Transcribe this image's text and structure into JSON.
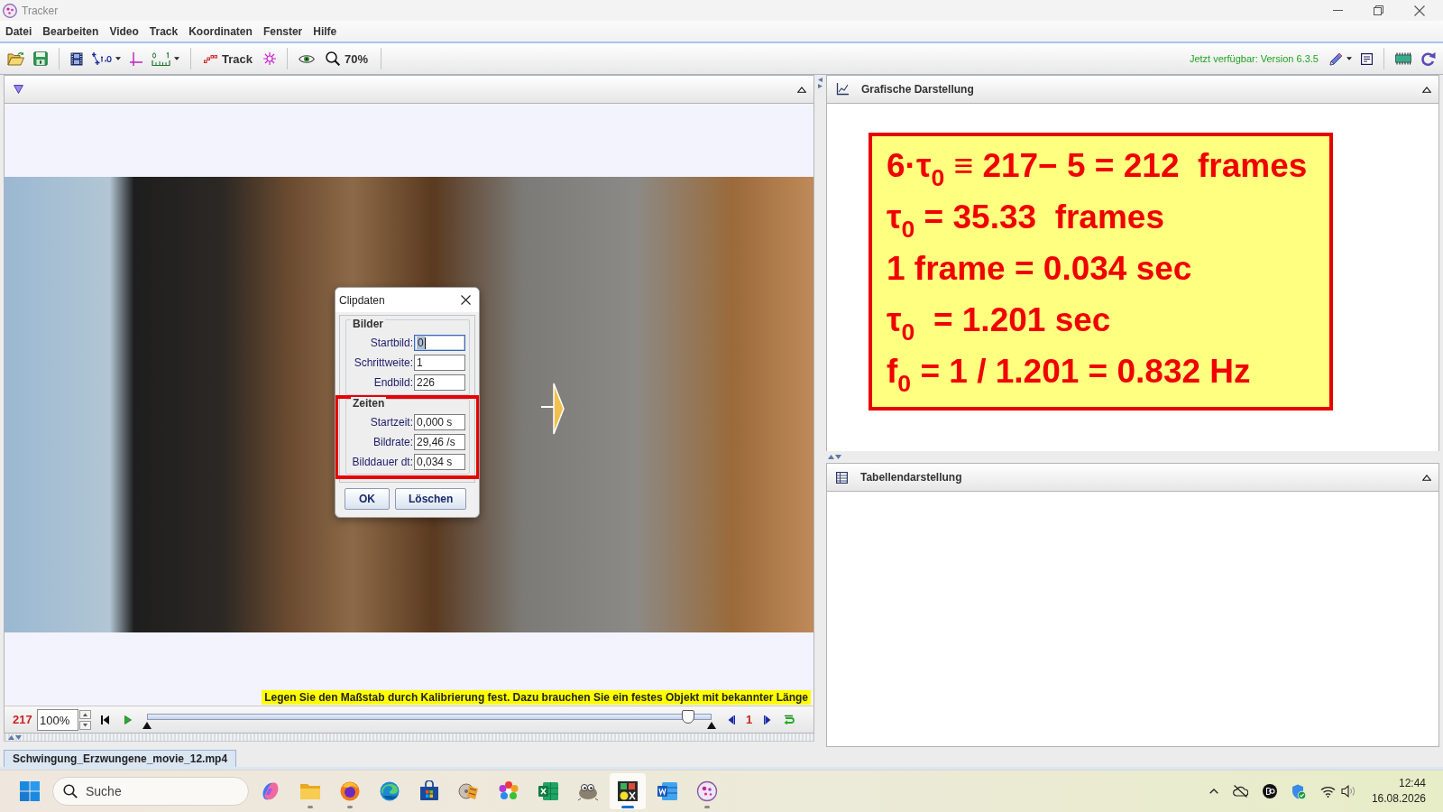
{
  "window": {
    "title": "Tracker"
  },
  "menu": [
    "Datei",
    "Bearbeiten",
    "Video",
    "Track",
    "Koordinaten",
    "Fenster",
    "Hilfe"
  ],
  "toolbar": {
    "track_button": "Track",
    "zoom_button": "70%",
    "update_notice": "Jetzt verfügbar: Version 6.3.5"
  },
  "video_panel": {
    "message": "Legen Sie den Maßstab durch Kalibrierung fest. Dazu brauchen Sie ein festes Objekt mit bekannter Länge",
    "player": {
      "frame": "217",
      "zoom": "100%",
      "level": 0.96,
      "step": "1"
    }
  },
  "dialog": {
    "title": "Clipdaten",
    "groups": [
      {
        "title": "Bilder",
        "highlighted": false,
        "fields": [
          {
            "label": "Startbild:",
            "value": "0",
            "focused": true
          },
          {
            "label": "Schrittweite:",
            "value": "1",
            "focused": false
          },
          {
            "label": "Endbild:",
            "value": "226",
            "focused": false
          }
        ]
      },
      {
        "title": "Zeiten",
        "highlighted": true,
        "fields": [
          {
            "label": "Startzeit:",
            "value": "0,000 s",
            "focused": false
          },
          {
            "label": "Bildrate:",
            "value": "29,46 /s",
            "focused": false
          },
          {
            "label": "Bilddauer dt:",
            "value": "0,034 s",
            "focused": false
          }
        ]
      }
    ],
    "buttons": [
      "OK",
      "Löschen"
    ]
  },
  "graph_panel": {
    "title": "Grafische Darstellung",
    "formula_lines": [
      "6·τ$_{0}$ ≡ 217− 5 = 212  frames",
      "τ$_{0}$ = 35.33  frames",
      "1 frame = 0.034 sec",
      "τ$_{0}$  = 1.201 sec",
      "f$_{0}$ = 1 / 1.201 = 0.832 Hz"
    ]
  },
  "table_panel": {
    "title": "Tabellendarstellung"
  },
  "file_tabs": [
    {
      "label": "Schwingung_Erzwungene_movie_12.mp4",
      "selected": true
    }
  ],
  "taskbar": {
    "search": {
      "placeholder": "Suche"
    },
    "apps": [
      {
        "kind": "swirl",
        "running": false,
        "selected": false
      },
      {
        "kind": "folder",
        "running": true,
        "selected": false
      },
      {
        "kind": "globe",
        "running": true,
        "selected": false
      },
      {
        "kind": "wave",
        "running": false,
        "selected": false
      },
      {
        "kind": "bag",
        "running": false,
        "selected": false
      },
      {
        "kind": "reel",
        "running": false,
        "selected": false
      },
      {
        "kind": "flower",
        "running": false,
        "selected": false
      },
      {
        "kind": "sheet",
        "running": false,
        "selected": false
      },
      {
        "kind": "mascot",
        "running": false,
        "selected": false
      },
      {
        "kind": "film",
        "running": true,
        "selected": true
      },
      {
        "kind": "doc",
        "running": false,
        "selected": false
      },
      {
        "kind": "disc",
        "running": true,
        "selected": false
      }
    ],
    "time": "12:44",
    "date": "16.08.2026"
  }
}
